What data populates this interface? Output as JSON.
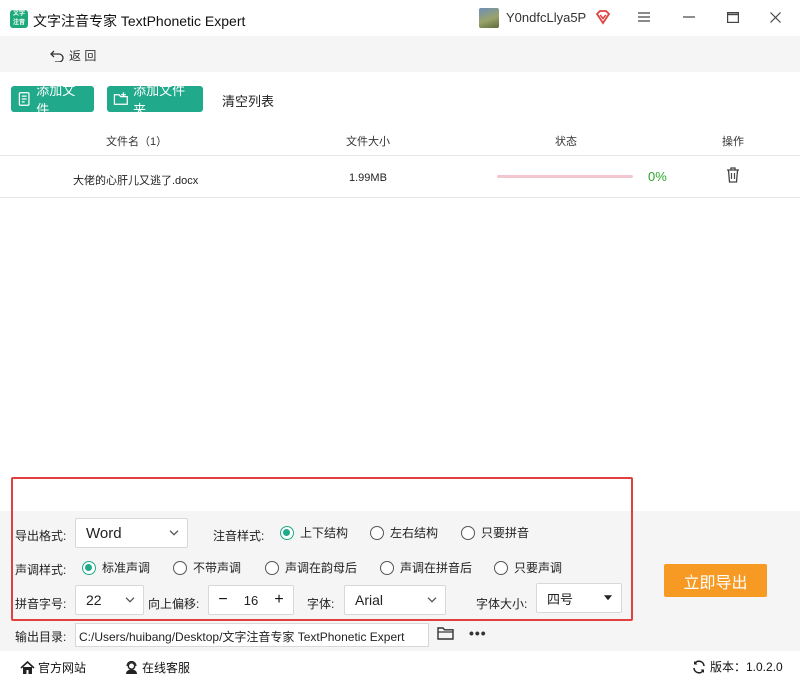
{
  "window": {
    "title": "文字注音专家 TextPhonetic Expert",
    "logo_text": "文字\n注音",
    "username": "Y0ndfcLlya5P"
  },
  "nav": {
    "back_label": "返 回"
  },
  "toolbar": {
    "add_file": "添加文件",
    "add_folder": "添加文件夹",
    "clear_list": "清空列表"
  },
  "table": {
    "headers": {
      "name": "文件名（1）",
      "size": "文件大小",
      "status": "状态",
      "action": "操作"
    },
    "rows": [
      {
        "name": "大佬的心肝儿又逃了.docx",
        "size": "1.99MB",
        "progress": 0,
        "percent": "0%"
      }
    ]
  },
  "settings": {
    "export_format_label": "导出格式:",
    "export_format_value": "Word",
    "annotation_label": "注音样式:",
    "annotation_options": [
      "上下结构",
      "左右结构",
      "只要拼音"
    ],
    "annotation_selected": 0,
    "tone_label": "声调样式:",
    "tone_options": [
      "标准声调",
      "不带声调",
      "声调在韵母后",
      "声调在拼音后",
      "只要声调"
    ],
    "tone_selected": 0,
    "pinyin_size_label": "拼音字号:",
    "pinyin_size_value": "22",
    "offset_label": "向上偏移:",
    "offset_value": "16",
    "font_label": "字体:",
    "font_value": "Arial",
    "font_size_label": "字体大小:",
    "font_size_value": "四号",
    "export_button": "立即导出",
    "output_label": "输出目录:",
    "output_path": "C:/Users/huibang/Desktop/文字注音专家 TextPhonetic Expert"
  },
  "footer": {
    "site": "官方网站",
    "service": "在线客服",
    "version": "版本：1.0.2.0"
  },
  "colors": {
    "accent": "#20a98a",
    "export": "#f79a24",
    "highlight": "#e0403f",
    "progress_track": "#f3c7cf"
  }
}
